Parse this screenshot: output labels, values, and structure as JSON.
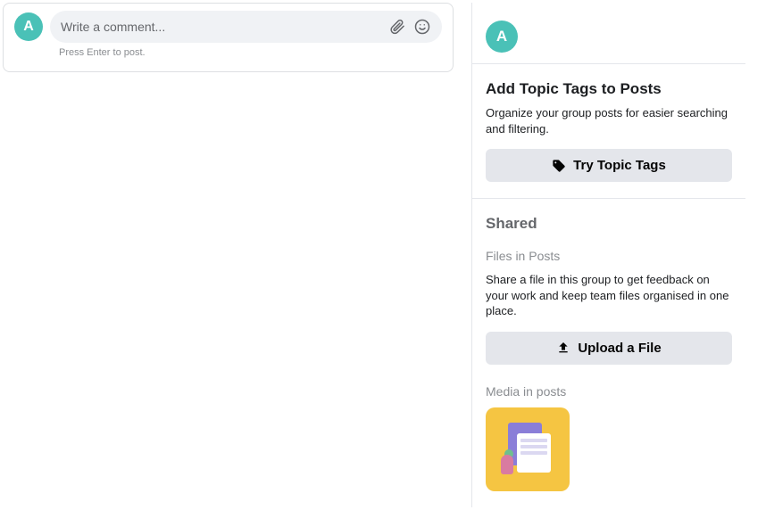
{
  "comment": {
    "avatar_initial": "A",
    "placeholder": "Write a comment...",
    "hint": "Press Enter to post."
  },
  "side_avatar": {
    "initial": "A"
  },
  "topic_tags": {
    "title": "Add Topic Tags to Posts",
    "desc": "Organize your group posts for easier searching and filtering.",
    "button": "Try Topic Tags"
  },
  "shared": {
    "title": "Shared",
    "files_sub": "Files in Posts",
    "files_desc": "Share a file in this group to get feedback on your work and keep team files organised in one place.",
    "upload_button": "Upload a File",
    "media_sub": "Media in posts"
  }
}
